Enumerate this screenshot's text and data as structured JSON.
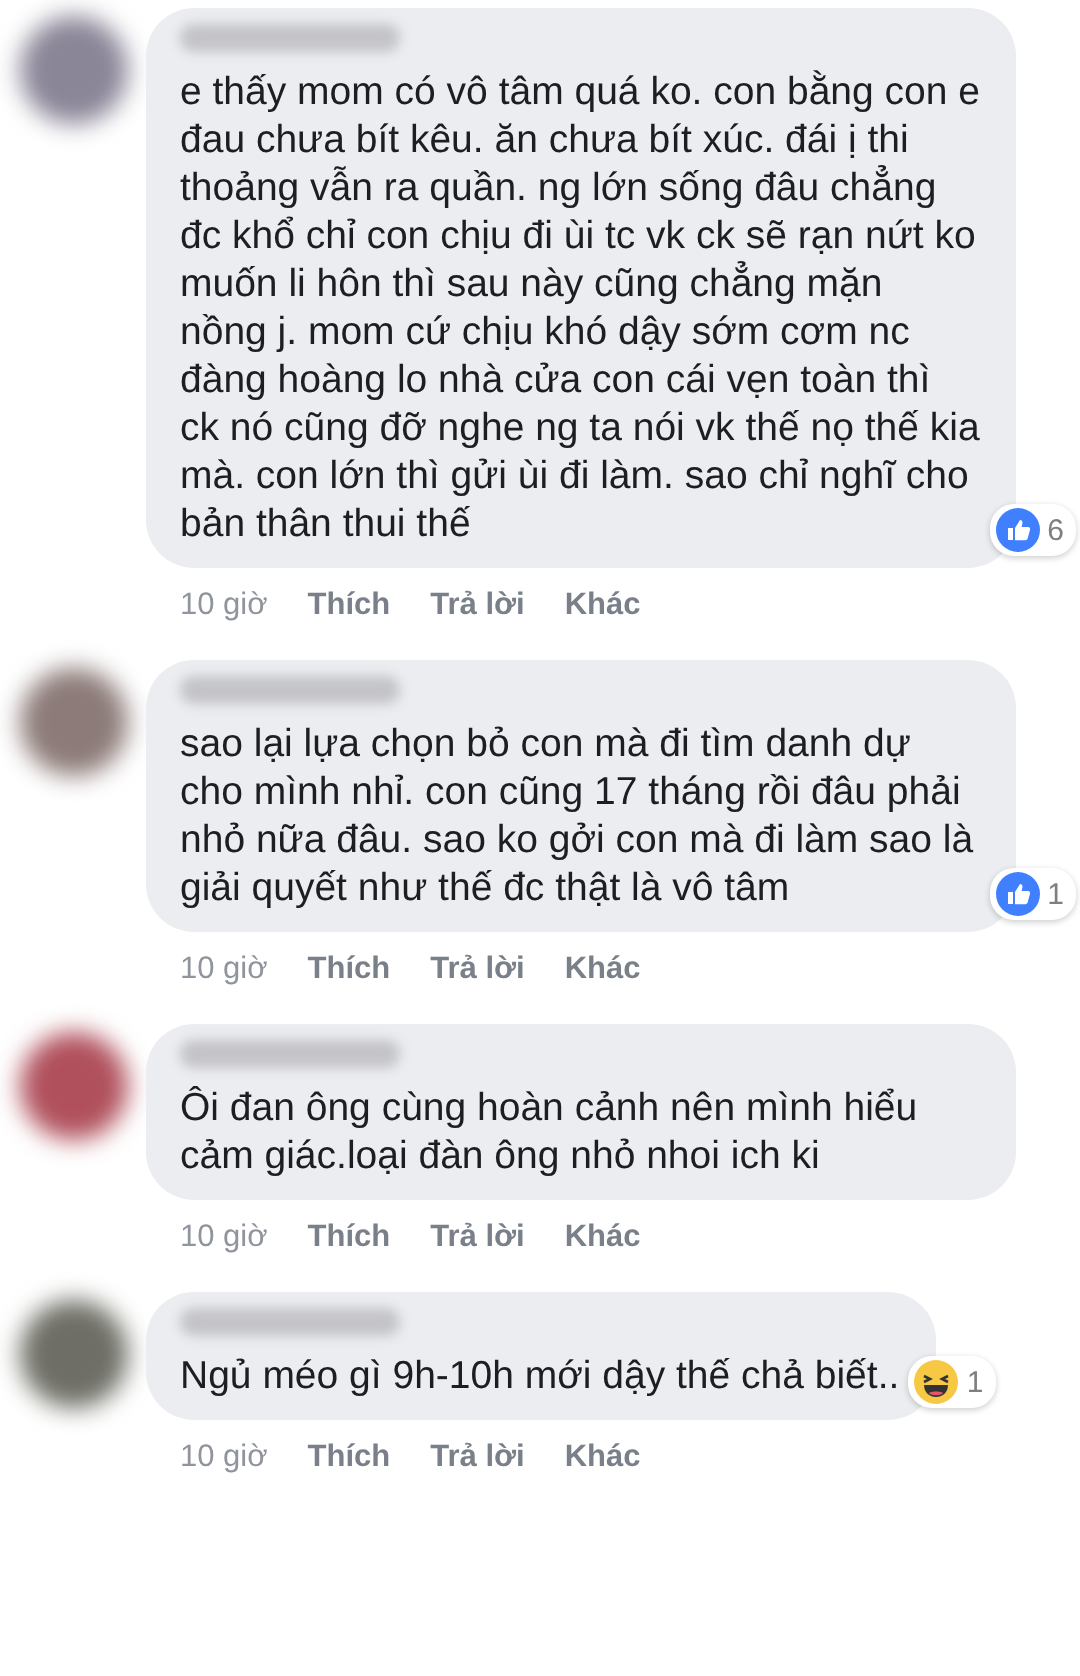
{
  "comments": [
    {
      "color": "#8a8597",
      "text": "e thấy mom có vô tâm quá ko. con bằng con e đau chưa bít kêu. ăn chưa bít xúc. đái ị thi thoảng vẫn ra quần. ng lớn sống đâu chẳng đc khổ chỉ con chịu đi ùi tc vk ck sẽ rạn nứt ko muốn li hôn thì sau này cũng chẳng mặn nồng j. mom cứ chịu khó dậy sớm cơm nc đàng hoàng lo nhà cửa con cái vẹn toàn thì ck nó cũng đỡ nghe ng ta nói vk thế nọ thế kia mà. con lớn thì gửi ùi đi làm. sao chỉ nghĩ cho bản thân thui thế",
      "reaction": {
        "kind": "like",
        "count": "6"
      },
      "time": "10 giờ",
      "actions": [
        "Thích",
        "Trả lời",
        "Khác"
      ]
    },
    {
      "color": "#8c7b78",
      "text": "sao lại lựa chọn bỏ con mà đi tìm danh dự cho mình nhỉ. con cũng 17 tháng rồi đâu phải nhỏ nữa đâu. sao ko gởi con mà đi làm sao là giải quyết như thế đc thật là vô tâm",
      "reaction": {
        "kind": "like",
        "count": "1"
      },
      "time": "10 giờ",
      "actions": [
        "Thích",
        "Trả lời",
        "Khác"
      ]
    },
    {
      "color": "#b0505c",
      "text": "Ôi đan ông cùng hoàn cảnh nên mình hiểu cảm giác.loại đàn ông nhỏ nhoi ich ki",
      "time": "10 giờ",
      "actions": [
        "Thích",
        "Trả lời",
        "Khác"
      ]
    },
    {
      "color": "#6e6e66",
      "text": "Ngủ méo gì 9h-10h mới dậy thế chả biết..",
      "reaction": {
        "kind": "haha",
        "count": "1"
      },
      "time": "10 giờ",
      "actions": [
        "Thích",
        "Trả lời",
        "Khác"
      ]
    }
  ]
}
